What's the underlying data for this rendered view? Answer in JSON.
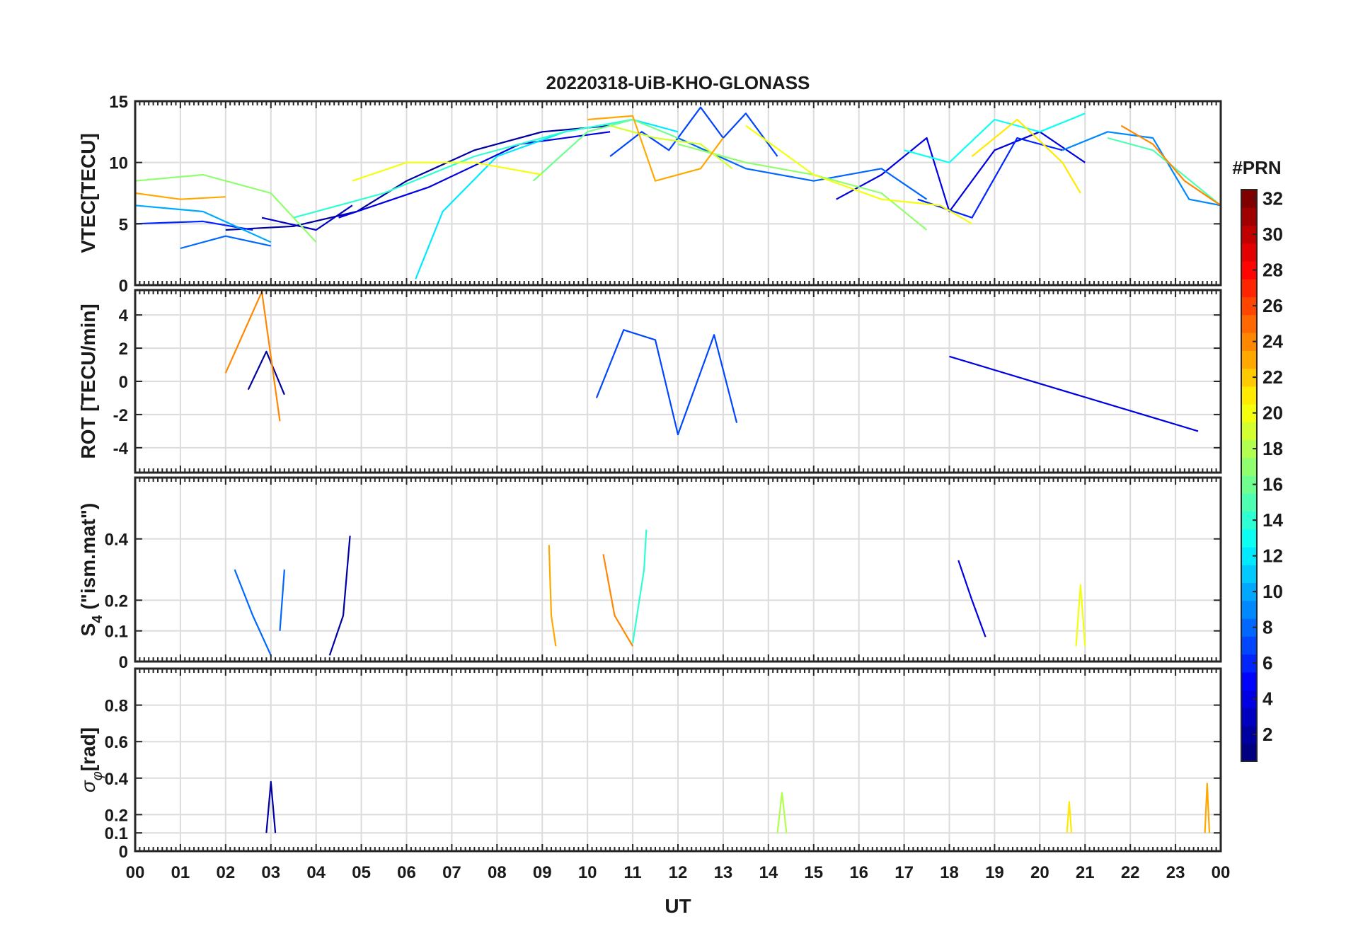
{
  "chart_data": {
    "type": "line",
    "title": "20220318-UiB-KHO-GLONASS",
    "xlabel": "UT",
    "x_tick_labels": [
      "00",
      "01",
      "02",
      "03",
      "04",
      "05",
      "06",
      "07",
      "08",
      "09",
      "10",
      "11",
      "12",
      "13",
      "14",
      "15",
      "16",
      "17",
      "18",
      "19",
      "20",
      "21",
      "22",
      "23",
      "00"
    ],
    "xlim": [
      0,
      24
    ],
    "grid": true,
    "colorbar": {
      "label": "#PRN",
      "range": [
        1,
        32
      ],
      "tick_labels": [
        "2",
        "4",
        "6",
        "8",
        "10",
        "12",
        "14",
        "16",
        "18",
        "20",
        "22",
        "24",
        "26",
        "28",
        "30",
        "32"
      ],
      "colormap": "jet"
    },
    "panels": [
      {
        "ylabel": "VTEC[TECU]",
        "ylim": [
          0,
          15
        ],
        "y_tick_labels": [
          "0",
          "5",
          "10",
          "15"
        ],
        "y_ticks": [
          0,
          5,
          10,
          15
        ],
        "series": [
          {
            "prn": 2,
            "x": [
              2.0,
              3.5,
              4.9,
              6.0,
              7.5,
              9.0,
              10.5
            ],
            "y": [
              4.5,
              4.8,
              6.0,
              8.5,
              11.0,
              12.5,
              13.0
            ]
          },
          {
            "prn": 3,
            "x": [
              2.8,
              4.0,
              4.8
            ],
            "y": [
              5.5,
              4.5,
              6.5
            ]
          },
          {
            "prn": 4,
            "x": [
              4.5,
              6.5,
              8.5,
              10.5
            ],
            "y": [
              5.5,
              8.0,
              11.5,
              12.5
            ]
          },
          {
            "prn": 4,
            "x": [
              15.5,
              16.5,
              17.5,
              18.0,
              19.0,
              20.0,
              21.0
            ],
            "y": [
              7.0,
              9.0,
              12.0,
              6.0,
              11.0,
              12.5,
              10.0
            ]
          },
          {
            "prn": 6,
            "x": [
              0.0,
              1.5,
              2.6
            ],
            "y": [
              5.0,
              5.2,
              4.5
            ]
          },
          {
            "prn": 6,
            "x": [
              17.3,
              18.5,
              19.5,
              20.5
            ],
            "y": [
              7.0,
              5.5,
              12.0,
              11.0
            ]
          },
          {
            "prn": 7,
            "x": [
              10.5,
              11.2,
              11.8,
              12.5,
              13.0,
              13.5,
              14.2
            ],
            "y": [
              10.5,
              12.5,
              11.0,
              14.5,
              12.0,
              14.0,
              10.5
            ]
          },
          {
            "prn": 8,
            "x": [
              1.0,
              2.0,
              3.0
            ],
            "y": [
              3.0,
              4.0,
              3.2
            ]
          },
          {
            "prn": 8,
            "x": [
              12.0,
              13.5,
              15.0,
              16.5,
              17.5
            ],
            "y": [
              12.0,
              9.5,
              8.5,
              9.5,
              7.0
            ]
          },
          {
            "prn": 9,
            "x": [
              20.5,
              21.5,
              22.5,
              23.3,
              24.0
            ],
            "y": [
              11.0,
              12.5,
              12.0,
              7.0,
              6.5
            ]
          },
          {
            "prn": 10,
            "x": [
              0.0,
              1.5,
              3.0
            ],
            "y": [
              6.5,
              6.0,
              3.5
            ]
          },
          {
            "prn": 12,
            "x": [
              6.2,
              6.8,
              8.0,
              9.5,
              11.0,
              12.0
            ],
            "y": [
              0.5,
              6.0,
              10.5,
              12.5,
              13.5,
              12.5
            ]
          },
          {
            "prn": 13,
            "x": [
              17.0,
              18.0,
              19.0,
              20.0,
              21.0
            ],
            "y": [
              11.0,
              10.0,
              13.5,
              12.5,
              14.0
            ]
          },
          {
            "prn": 14,
            "x": [
              3.5,
              5.5,
              7.5,
              9.5,
              11.0
            ],
            "y": [
              5.5,
              7.5,
              10.5,
              12.5,
              13.5
            ]
          },
          {
            "prn": 15,
            "x": [
              21.5,
              22.5,
              23.5,
              24.0
            ],
            "y": [
              12.0,
              11.0,
              8.0,
              6.5
            ]
          },
          {
            "prn": 16,
            "x": [
              8.8,
              10.0,
              11.0,
              12.0
            ],
            "y": [
              8.5,
              12.5,
              13.5,
              12.0
            ]
          },
          {
            "prn": 17,
            "x": [
              0.0,
              1.5,
              3.0,
              4.0
            ],
            "y": [
              8.5,
              9.0,
              7.5,
              3.5
            ]
          },
          {
            "prn": 17,
            "x": [
              12.0,
              13.5,
              15.0,
              16.5,
              17.5
            ],
            "y": [
              11.5,
              10.0,
              9.0,
              7.5,
              4.5
            ]
          },
          {
            "prn": 19,
            "x": [
              10.5,
              11.5,
              12.5,
              13.2
            ],
            "y": [
              13.0,
              12.0,
              11.5,
              9.5
            ]
          },
          {
            "prn": 20,
            "x": [
              4.8,
              6.0,
              7.5,
              9.0
            ],
            "y": [
              8.5,
              10.0,
              10.0,
              9.0
            ]
          },
          {
            "prn": 20,
            "x": [
              13.5,
              15.0,
              16.5,
              17.8,
              18.5
            ],
            "y": [
              13.0,
              9.0,
              7.0,
              6.5,
              5.0
            ]
          },
          {
            "prn": 21,
            "x": [
              18.5,
              19.5,
              20.5,
              20.9
            ],
            "y": [
              10.5,
              13.5,
              10.0,
              7.5
            ]
          },
          {
            "prn": 23,
            "x": [
              0.0,
              1.0,
              2.0
            ],
            "y": [
              7.5,
              7.0,
              7.2
            ]
          },
          {
            "prn": 23,
            "x": [
              10.0,
              11.0,
              11.5,
              12.5,
              13.0
            ],
            "y": [
              13.5,
              13.8,
              8.5,
              9.5,
              12.0
            ]
          },
          {
            "prn": 24,
            "x": [
              21.8,
              22.5,
              23.2,
              24.0
            ],
            "y": [
              13.0,
              11.5,
              8.5,
              6.5
            ]
          }
        ]
      },
      {
        "ylabel": "ROT [TECU/min]",
        "ylim": [
          -5.5,
          5.5
        ],
        "y_tick_labels": [
          "-4",
          "-2",
          "0",
          "2",
          "4"
        ],
        "y_ticks": [
          -4,
          -2,
          0,
          2,
          4
        ],
        "series": [
          {
            "prn": 2,
            "x": [
              2.5,
              2.9,
              3.3
            ],
            "y": [
              -0.5,
              1.8,
              -0.8
            ]
          },
          {
            "prn": 7,
            "x": [
              10.2,
              10.8,
              11.5,
              12.0,
              12.8,
              13.3
            ],
            "y": [
              -1.0,
              3.1,
              2.5,
              -3.2,
              2.8,
              -2.5
            ]
          },
          {
            "prn": 24,
            "x": [
              2.0,
              2.8,
              3.2
            ],
            "y": [
              0.5,
              5.4,
              -2.4
            ]
          },
          {
            "prn": 4,
            "x": [
              18.0,
              23.5
            ],
            "y": [
              1.5,
              -3.0
            ]
          }
        ]
      },
      {
        "ylabel": "S_4 (\"ism.mat\")",
        "ylim": [
          0,
          0.6
        ],
        "y_tick_labels": [
          "0",
          "0.1",
          "0.2",
          "0.4"
        ],
        "y_ticks": [
          0,
          0.1,
          0.2,
          0.4
        ],
        "series": [
          {
            "prn": 2,
            "x": [
              4.3,
              4.6,
              4.75
            ],
            "y": [
              0.02,
              0.15,
              0.41
            ]
          },
          {
            "prn": 8,
            "x": [
              2.2,
              2.6,
              3.0
            ],
            "y": [
              0.3,
              0.15,
              0.02
            ]
          },
          {
            "prn": 8,
            "x": [
              3.2,
              3.3
            ],
            "y": [
              0.1,
              0.3
            ]
          },
          {
            "prn": 23,
            "x": [
              9.15,
              9.2,
              9.3
            ],
            "y": [
              0.38,
              0.15,
              0.05
            ]
          },
          {
            "prn": 24,
            "x": [
              10.35,
              10.6,
              11.0
            ],
            "y": [
              0.35,
              0.15,
              0.05
            ]
          },
          {
            "prn": 14,
            "x": [
              11.0,
              11.25,
              11.3
            ],
            "y": [
              0.06,
              0.3,
              0.43
            ]
          },
          {
            "prn": 4,
            "x": [
              18.2,
              18.5,
              18.8
            ],
            "y": [
              0.33,
              0.2,
              0.08
            ]
          },
          {
            "prn": 20,
            "x": [
              20.8,
              20.9,
              21.0
            ],
            "y": [
              0.05,
              0.25,
              0.05
            ]
          }
        ]
      },
      {
        "ylabel": "σ_φ[rad]",
        "ylim": [
          0,
          1.0
        ],
        "y_tick_labels": [
          "0",
          "0.1",
          "0.2",
          "0.4",
          "0.6",
          "0.8"
        ],
        "y_ticks": [
          0,
          0.1,
          0.2,
          0.4,
          0.6,
          0.8
        ],
        "series": [
          {
            "prn": 2,
            "x": [
              2.9,
              3.0,
              3.1
            ],
            "y": [
              0.1,
              0.38,
              0.1
            ]
          },
          {
            "prn": 18,
            "x": [
              14.2,
              14.3,
              14.4
            ],
            "y": [
              0.1,
              0.32,
              0.1
            ]
          },
          {
            "prn": 21,
            "x": [
              20.6,
              20.65,
              20.7
            ],
            "y": [
              0.1,
              0.27,
              0.1
            ]
          },
          {
            "prn": 23,
            "x": [
              23.65,
              23.7,
              23.75
            ],
            "y": [
              0.1,
              0.37,
              0.1
            ]
          }
        ]
      }
    ]
  }
}
